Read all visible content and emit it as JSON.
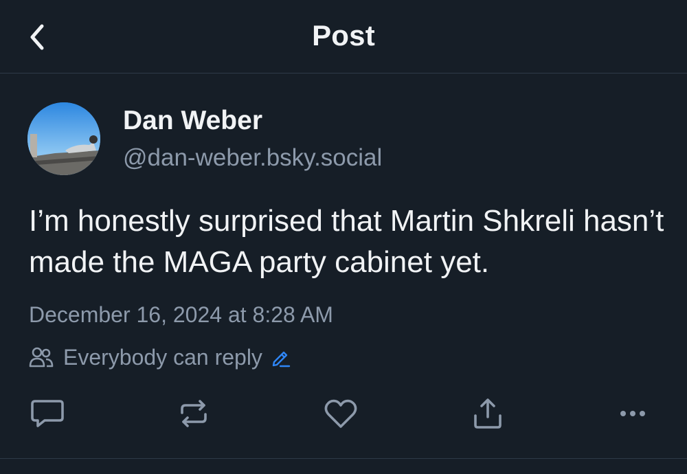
{
  "header": {
    "title": "Post",
    "back_icon": "chevron-left-icon"
  },
  "author": {
    "display_name": "Dan Weber",
    "handle": "@dan-weber.bsky.social",
    "avatar_icon": "avatar"
  },
  "post": {
    "text": "I’m honestly surprised that Martin Shkreli hasn’t made the MAGA party cabinet yet.",
    "timestamp": "December 16, 2024 at 8:28 AM"
  },
  "reply_setting": {
    "label": "Everybody can reply",
    "icon": "people-icon",
    "edit_icon": "pencil-icon"
  },
  "actions": {
    "reply_icon": "comment-icon",
    "repost_icon": "repost-icon",
    "like_icon": "heart-icon",
    "share_icon": "share-icon",
    "more_icon": "more-icon"
  },
  "colors": {
    "background": "#161e27",
    "primary_text": "#f1f3f5",
    "secondary_text": "#8d9aab",
    "accent": "#2f86f6",
    "divider": "#2e3a48"
  }
}
